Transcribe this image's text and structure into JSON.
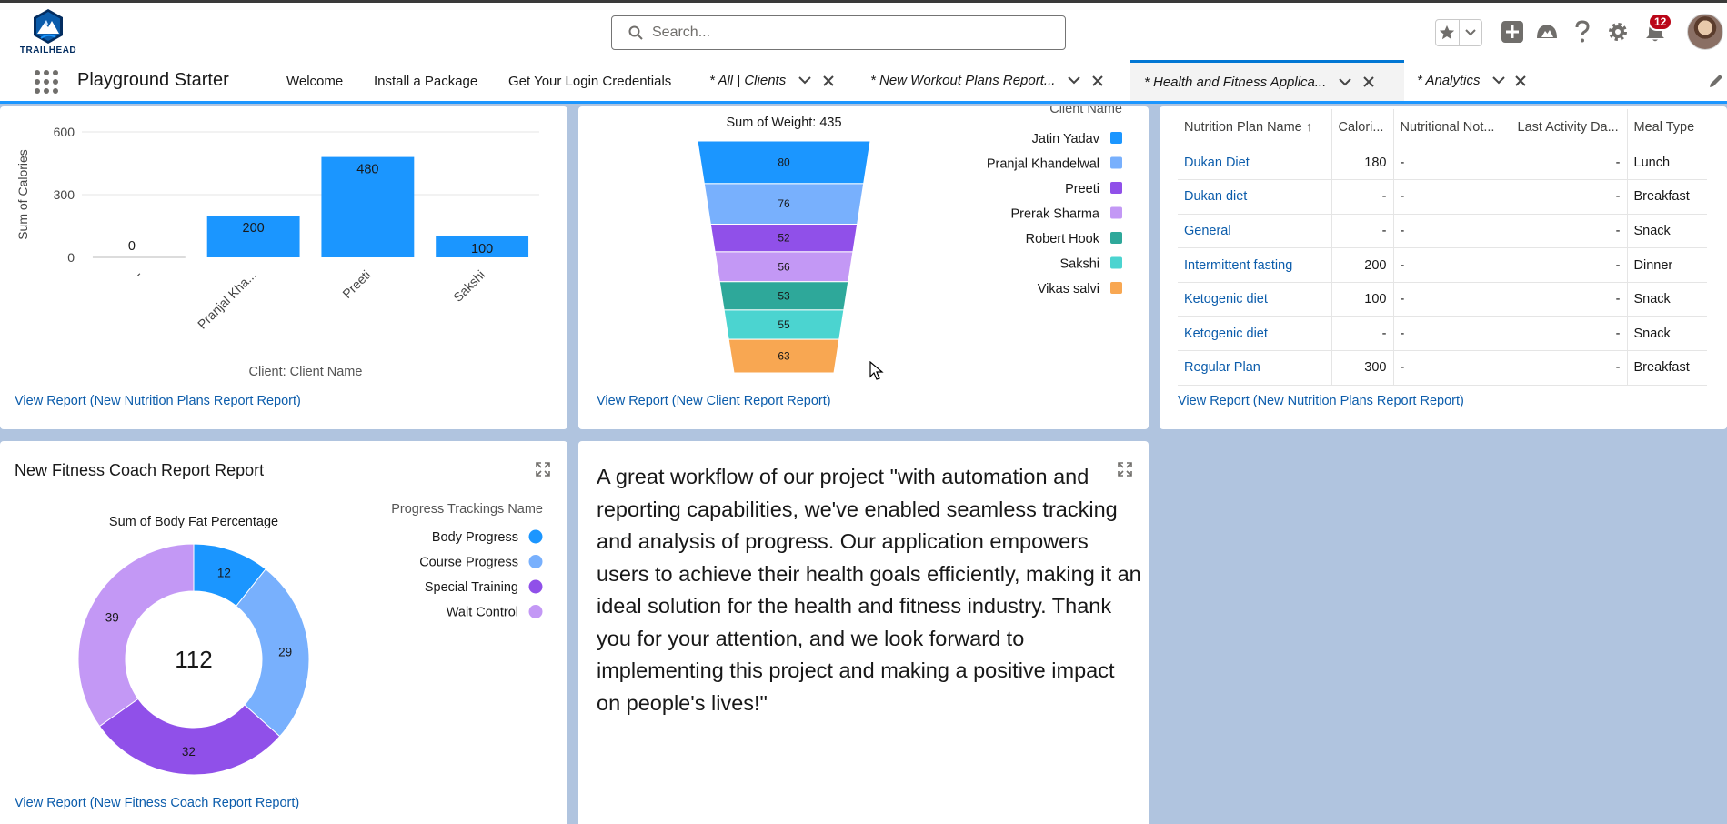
{
  "header": {
    "logo_text": "TRAILHEAD",
    "search_placeholder": "Search...",
    "notification_count": "12"
  },
  "nav": {
    "app_name": "Playground Starter",
    "items": [
      "Welcome",
      "Install a Package",
      "Get Your Login Credentials"
    ],
    "tabs": [
      {
        "label": "* All | Clients"
      },
      {
        "label": "* New Workout Plans Report..."
      },
      {
        "label": "* Health and Fitness Applica..."
      },
      {
        "label": "* Analytics"
      }
    ]
  },
  "nutrition_chart": {
    "chart_data": {
      "type": "bar",
      "categories": [
        "-",
        "Pranjal Kha...",
        "Preeti",
        "Sakshi"
      ],
      "values": [
        0,
        200,
        480,
        100
      ],
      "ylabel": "Sum of Calories",
      "xlabel": "Client: Client Name",
      "yticks": [
        0,
        300,
        600
      ],
      "ylim": [
        0,
        600
      ],
      "color": "#1b96ff"
    },
    "link": "View Report (New Nutrition Plans Report Report)"
  },
  "client_chart": {
    "chart_data": {
      "type": "funnel",
      "title": "Sum of Weight: 435",
      "legend_title": "Client Name",
      "series": [
        {
          "name": "Jatin Yadav",
          "value": 80,
          "color": "#1b96ff"
        },
        {
          "name": "Pranjal Khandelwal",
          "value": 76,
          "color": "#78b0fd"
        },
        {
          "name": "Preeti",
          "value": 52,
          "color": "#9050e9"
        },
        {
          "name": "Prerak Sharma",
          "value": 56,
          "color": "#c398f5"
        },
        {
          "name": "Robert Hook",
          "value": 53,
          "color": "#2ea89a"
        },
        {
          "name": "Sakshi",
          "value": 55,
          "color": "#4bd4d0"
        },
        {
          "name": "Vikas salvi",
          "value": 63,
          "color": "#f8a752"
        }
      ]
    },
    "link": "View Report (New Client Report Report)"
  },
  "nutrition_table": {
    "columns": [
      "Nutrition Plan Name",
      "Calori...",
      "Nutritional Not...",
      "Last Activity Da...",
      "Meal Type"
    ],
    "rows": [
      {
        "name": "Dukan Diet",
        "calories": "180",
        "notes": "-",
        "last_activity": "-",
        "meal": "Lunch"
      },
      {
        "name": "Dukan diet",
        "calories": "-",
        "notes": "-",
        "last_activity": "-",
        "meal": "Breakfast"
      },
      {
        "name": "General",
        "calories": "-",
        "notes": "-",
        "last_activity": "-",
        "meal": "Snack"
      },
      {
        "name": "Intermittent fasting",
        "calories": "200",
        "notes": "-",
        "last_activity": "-",
        "meal": "Dinner"
      },
      {
        "name": "Ketogenic diet",
        "calories": "100",
        "notes": "-",
        "last_activity": "-",
        "meal": "Snack"
      },
      {
        "name": "Ketogenic diet",
        "calories": "-",
        "notes": "-",
        "last_activity": "-",
        "meal": "Snack"
      },
      {
        "name": "Regular Plan",
        "calories": "300",
        "notes": "-",
        "last_activity": "-",
        "meal": "Breakfast"
      }
    ],
    "link": "View Report (New Nutrition Plans Report Report)"
  },
  "fitness_coach": {
    "title": "New Fitness Coach Report Report",
    "chart_data": {
      "type": "donut",
      "title": "Sum of Body Fat Percentage",
      "total": "112",
      "legend_title": "Progress Trackings Name",
      "series": [
        {
          "name": "Body Progress",
          "value": 12,
          "color": "#1b96ff"
        },
        {
          "name": "Course Progress",
          "value": 29,
          "color": "#78b0fd"
        },
        {
          "name": "Special Training",
          "value": 32,
          "color": "#9050e9"
        },
        {
          "name": "Wait Control",
          "value": 39,
          "color": "#c398f5"
        }
      ]
    },
    "link": "View Report (New Fitness Coach Report Report)"
  },
  "summary_text": "A great workflow of our project \"with automation and reporting capabilities, we've enabled seamless tracking and analysis of progress. Our application empowers users to achieve their health goals efficiently, making it an ideal solution for the health and fitness industry. Thank you for your attention, and we look forward to implementing this project and making a positive impact on people's lives!\""
}
